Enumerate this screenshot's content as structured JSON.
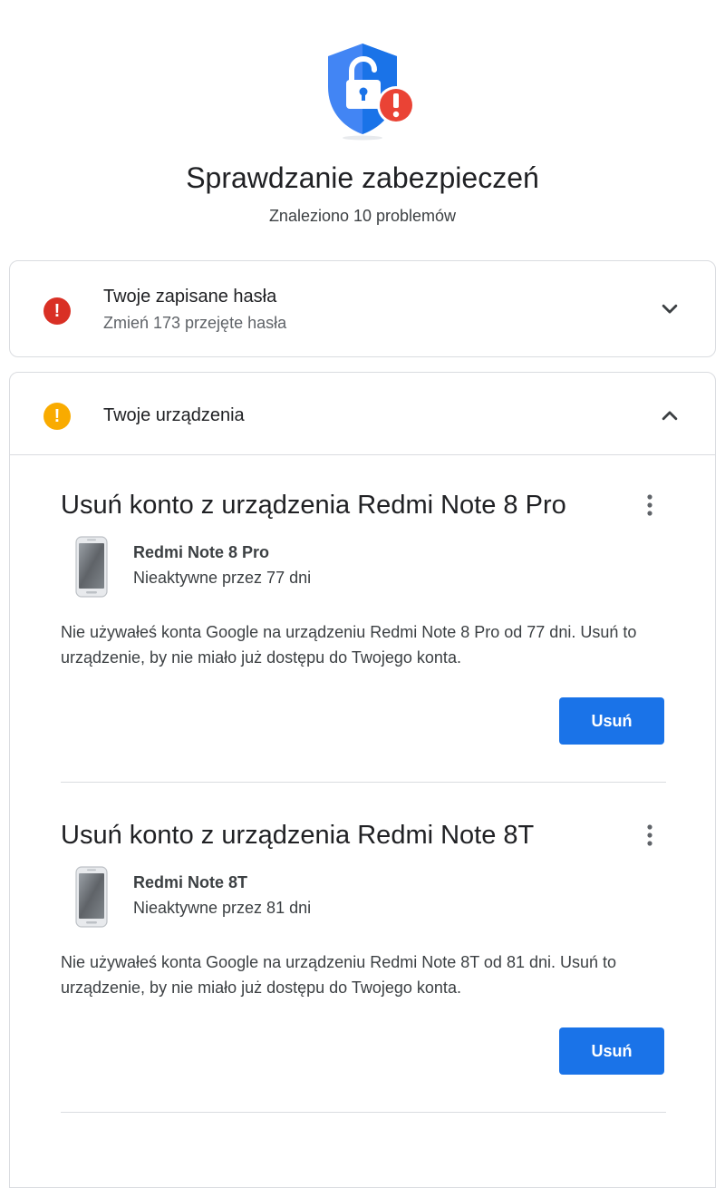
{
  "header": {
    "title": "Sprawdzanie zabezpieczeń",
    "subtitle": "Znaleziono 10 problemów",
    "icon": "shield-lock-alert-icon"
  },
  "passwords_card": {
    "status_icon": "error-icon",
    "status_color": "#d93025",
    "title": "Twoje zapisane hasła",
    "subtitle": "Zmień 173 przejęte hasła",
    "expanded": false
  },
  "devices_card": {
    "status_icon": "warning-icon",
    "status_color": "#f9ab00",
    "title": "Twoje urządzenia",
    "expanded": true,
    "devices": [
      {
        "heading": "Usuń konto z urządzenia Redmi Note 8 Pro",
        "name": "Redmi Note 8 Pro",
        "status": "Nieaktywne przez 77 dni",
        "description": "Nie używałeś konta Google na urządzeniu Redmi Note 8 Pro od 77 dni. Usuń to urządzenie, by nie miało już dostępu do Twojego konta.",
        "button_label": "Usuń"
      },
      {
        "heading": "Usuń konto z urządzenia Redmi Note 8T",
        "name": "Redmi Note 8T",
        "status": "Nieaktywne przez 81 dni",
        "description": "Nie używałeś konta Google na urządzeniu Redmi Note 8T od 81 dni. Usuń to urządzenie, by nie miało już dostępu do Twojego konta.",
        "button_label": "Usuń"
      }
    ]
  },
  "colors": {
    "primary": "#1a73e8",
    "error": "#d93025",
    "warning": "#f9ab00",
    "shield": "#4285f4"
  }
}
